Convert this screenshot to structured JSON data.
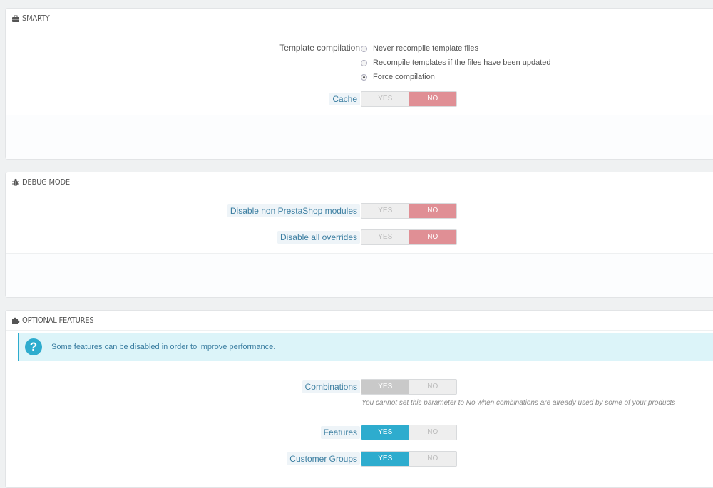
{
  "smarty": {
    "title": "SMARTY",
    "template_compilation_label": "Template compilation",
    "options": [
      {
        "label": "Never recompile template files",
        "checked": false
      },
      {
        "label": "Recompile templates if the files have been updated",
        "checked": false
      },
      {
        "label": "Force compilation",
        "checked": true
      }
    ],
    "cache_label": "Cache",
    "cache_yes": "YES",
    "cache_no": "NO",
    "cache_value": "NO"
  },
  "debug": {
    "title": "DEBUG MODE",
    "disable_modules_label": "Disable non PrestaShop modules",
    "disable_modules_yes": "YES",
    "disable_modules_no": "NO",
    "disable_modules_value": "NO",
    "disable_overrides_label": "Disable all overrides",
    "disable_overrides_yes": "YES",
    "disable_overrides_no": "NO",
    "disable_overrides_value": "NO"
  },
  "optional": {
    "title": "OPTIONAL FEATURES",
    "info_text": "Some features can be disabled in order to improve performance.",
    "combinations_label": "Combinations",
    "combinations_yes": "YES",
    "combinations_no": "NO",
    "combinations_value": "YES",
    "combinations_help": "You cannot set this parameter to No when combinations are already used by some of your products",
    "features_label": "Features",
    "features_yes": "YES",
    "features_no": "NO",
    "features_value": "YES",
    "groups_label": "Customer Groups",
    "groups_yes": "YES",
    "groups_no": "NO",
    "groups_value": "YES"
  },
  "colors": {
    "accent": "#2eacce",
    "no_active": "#e08f95",
    "info_bg": "#dcf4f9"
  }
}
